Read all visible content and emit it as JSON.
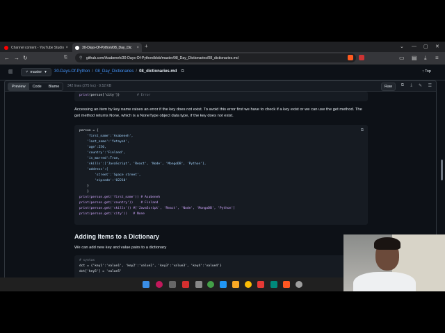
{
  "browser": {
    "tabs": [
      {
        "label": "Channel content - YouTube Studio",
        "active": false
      },
      {
        "label": "30-Days-Of-Python/08_Day_Dic",
        "active": true
      }
    ],
    "url": "github.com/Asabeneh/30-Days-Of-Python/blob/master/08_Day_Dictionaries/08_dictionaries.md"
  },
  "github": {
    "branch": "master",
    "breadcrumbs": [
      "30-Days-Of-Python",
      "08_Day_Dictionaries",
      "08_dictionaries.md"
    ],
    "top_label": "Top",
    "view_tabs": [
      "Preview",
      "Code",
      "Blame"
    ],
    "file_meta": "342 lines (275 loc) · 9.52 KB",
    "raw_label": "Raw"
  },
  "content": {
    "code_top": {
      "fn": "print",
      "arg": "person['city']",
      "comment": "# Error"
    },
    "paragraph": "Accessing an item by key name raises an error if the key does not exist. To avoid this error first we have to check if a key exist or we can use the get method. The get method returns None, which is a NoneType object data type, if the key does not exist.",
    "code_block": [
      "person = {",
      "    'first_name':'Asabeneh',",
      "    'last_name':'Yetayeh',",
      "    'age':250,",
      "    'country':'Finland',",
      "    'is_marred':True,",
      "    'skills':['JavaScript', 'React', 'Node', 'MongoDB', 'Python'],",
      "    'address':{",
      "        'street':'Space street',",
      "        'zipcode':'02210'",
      "    }",
      "    }",
      "print(person.get('first_name')) # Asabeneh",
      "print(person.get('country'))    # Finland",
      "print(person.get('skills')) #['JavaScript', 'React', 'Node', 'MongoDB', 'Python']",
      "print(person.get('city'))   # None"
    ],
    "heading": "Adding Items to a Dictionary",
    "paragraph2": "We can add new key and value pairs to a dictionary",
    "code_block2": [
      "# syntax",
      "dct = {'key1':'value1', 'key2':'value2', 'key3':'value3', 'key4':'value4'}",
      "dct['key5'] = 'value5'"
    ]
  },
  "colors": {
    "accent": "#4493f8",
    "bg": "#0d1117",
    "code_bg": "#161b22"
  }
}
